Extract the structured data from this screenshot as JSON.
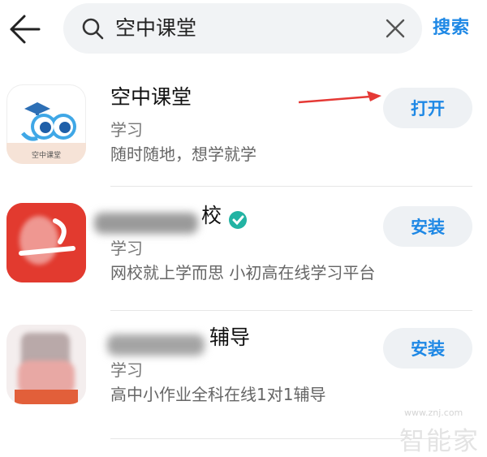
{
  "search": {
    "query": "空中课堂",
    "submit_label": "搜索"
  },
  "apps": [
    {
      "name": "空中课堂",
      "category": "学习",
      "description": "随时随地，想学就学",
      "action_label": "打开",
      "icon_caption": "空中课堂"
    },
    {
      "name_visible": "校",
      "category": "学习",
      "description": "网校就上学而思 小初高在线学习平台",
      "action_label": "安装"
    },
    {
      "name_visible": "辅导",
      "category": "学习",
      "description": "高中小作业全科在线1对1辅导",
      "action_label": "安装"
    }
  ],
  "watermark": {
    "text": "智能家",
    "url": "www.znj.com"
  },
  "colors": {
    "accent": "#1e88e5",
    "annotation_arrow": "#e53935",
    "verified_badge": "#22b3a3"
  }
}
